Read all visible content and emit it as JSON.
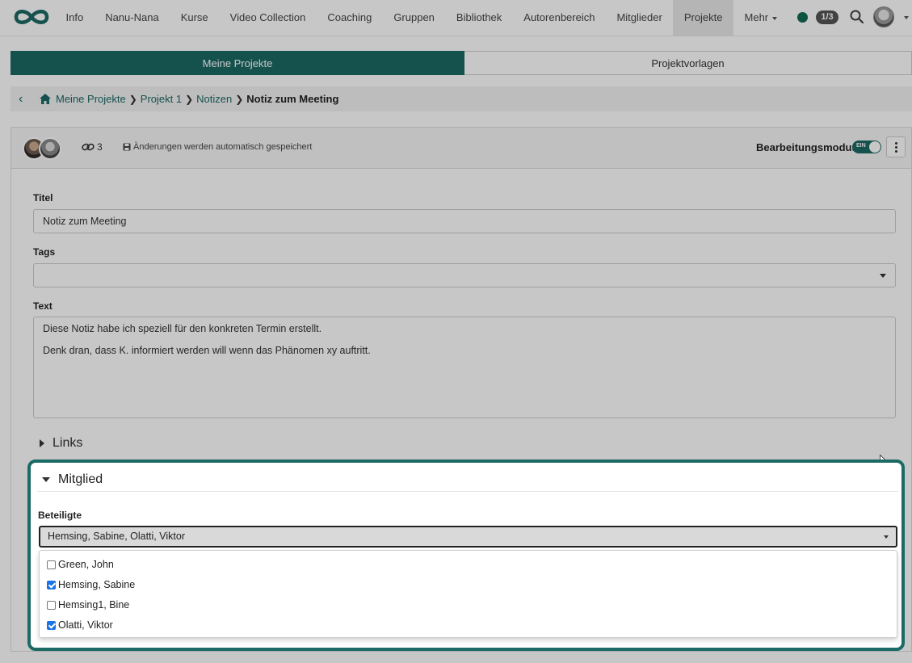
{
  "nav": {
    "items": [
      {
        "label": "Info",
        "active": false
      },
      {
        "label": "Nanu-Nana",
        "active": false
      },
      {
        "label": "Kurse",
        "active": false
      },
      {
        "label": "Video Collection",
        "active": false
      },
      {
        "label": "Coaching",
        "active": false
      },
      {
        "label": "Gruppen",
        "active": false
      },
      {
        "label": "Bibliothek",
        "active": false
      },
      {
        "label": "Autorenbereich",
        "active": false
      },
      {
        "label": "Mitglieder",
        "active": false
      },
      {
        "label": "Projekte",
        "active": true
      },
      {
        "label": "Mehr",
        "active": false
      }
    ],
    "counter": "1/3",
    "status_color": "#136a53"
  },
  "tabs": {
    "my_projects": "Meine Projekte",
    "templates": "Projektvorlagen"
  },
  "breadcrumb": {
    "items": [
      "Meine Projekte",
      "Projekt 1",
      "Notizen"
    ],
    "current": "Notiz zum Meeting"
  },
  "toolbar": {
    "link_count": "3",
    "autosave": "Änderungen werden automatisch gespeichert",
    "edit_mode_label": "Bearbeitungsmodus",
    "toggle_text": "EIN"
  },
  "form": {
    "title_label": "Titel",
    "title_value": "Notiz zum Meeting",
    "tags_label": "Tags",
    "text_label": "Text",
    "text_lines": [
      "Diese Notiz habe ich speziell für den konkreten Termin erstellt.",
      "Denk dran, dass K. informiert werden will wenn das Phänomen xy auftritt."
    ],
    "links_label": "Links"
  },
  "members": {
    "section_label": "Mitglied",
    "field_label": "Beteiligte",
    "selected_summary": "Hemsing, Sabine, Olatti, Viktor",
    "options": [
      {
        "label": "Green, John",
        "checked": false
      },
      {
        "label": "Hemsing, Sabine",
        "checked": true
      },
      {
        "label": "Hemsing1, Bine",
        "checked": false
      },
      {
        "label": "Olatti, Viktor",
        "checked": true
      }
    ]
  },
  "colors": {
    "accent": "#1b6a65",
    "checkbox": "#1a73e8"
  }
}
